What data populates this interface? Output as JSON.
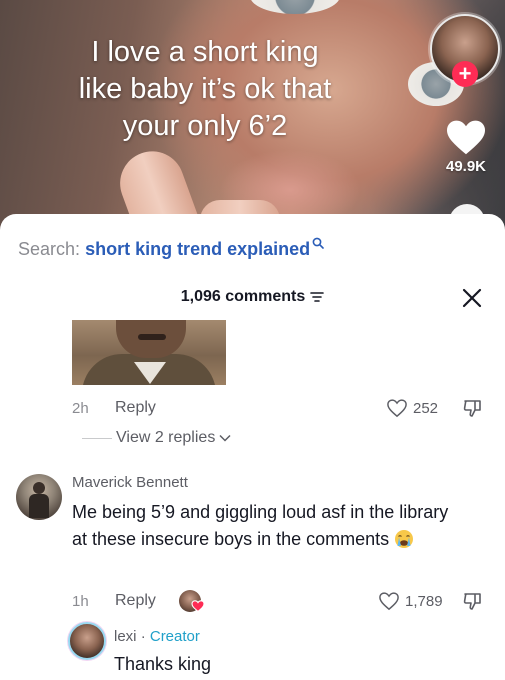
{
  "video": {
    "caption_lines": [
      "I love a short king",
      "like baby it’s ok that",
      "your only 6’2"
    ],
    "like_count": "49.9K",
    "follow_plus": "+"
  },
  "search": {
    "label": "Search:",
    "term": "short king trend explained"
  },
  "comments_header": {
    "count_label": "1,096 comments"
  },
  "comment_1": {
    "time": "2h",
    "reply_label": "Reply",
    "likes": "252",
    "view_replies": "View 2 replies"
  },
  "comment_2": {
    "username": "Maverick Bennett",
    "text": "Me being 5’9 and giggling loud asf in the library at these insecure boys in the comments",
    "time": "1h",
    "reply_label": "Reply",
    "likes": "1,789"
  },
  "creator_reply": {
    "username": "lexi",
    "separator": "·",
    "creator_label": "Creator",
    "text": "Thanks king"
  },
  "colors": {
    "search_term": "#2b5db7",
    "creator_label": "#20a0c9",
    "follow_plus": "#fe2c55"
  },
  "icons": [
    "search-icon",
    "filter-icon",
    "close-icon",
    "heart-icon",
    "dislike-icon",
    "chevron-down-icon",
    "crying-emoji-icon"
  ]
}
